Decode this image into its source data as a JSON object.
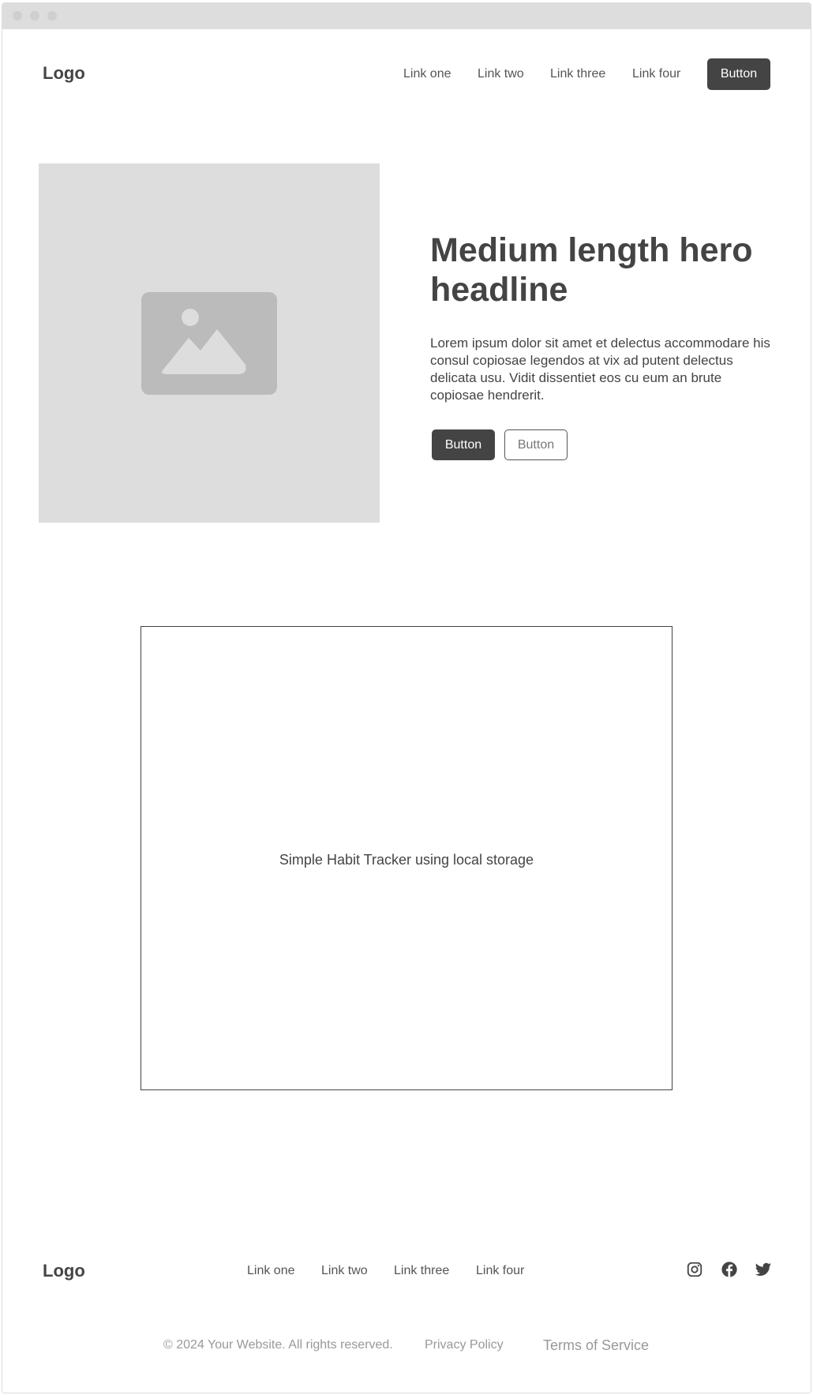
{
  "header": {
    "logo": "Logo",
    "nav": [
      "Link one",
      "Link two",
      "Link three",
      "Link four"
    ],
    "cta_label": "Button"
  },
  "hero": {
    "image_icon": "image-placeholder-icon",
    "headline": "Medium length hero headline",
    "body": "Lorem ipsum dolor sit amet et delectus accommodare his consul copiosae legendos at vix ad putent delectus delicata usu. Vidit dissentiet eos cu eum an brute copiosae hendrerit.",
    "primary_button": "Button",
    "secondary_button": "Button"
  },
  "app": {
    "label": "Simple Habit Tracker using local storage"
  },
  "footer": {
    "logo": "Logo",
    "nav": [
      "Link one",
      "Link two",
      "Link three",
      "Link four"
    ],
    "social_icons": [
      "instagram-icon",
      "facebook-icon",
      "twitter-icon"
    ],
    "copyright": "© 2024 Your Website. All rights reserved.",
    "privacy": "Privacy Policy",
    "terms": "Terms of Service"
  },
  "colors": {
    "dark": "#444444",
    "placeholder": "#dddddd",
    "icon_fill": "#bbbbbb",
    "muted_text": "#999999"
  }
}
